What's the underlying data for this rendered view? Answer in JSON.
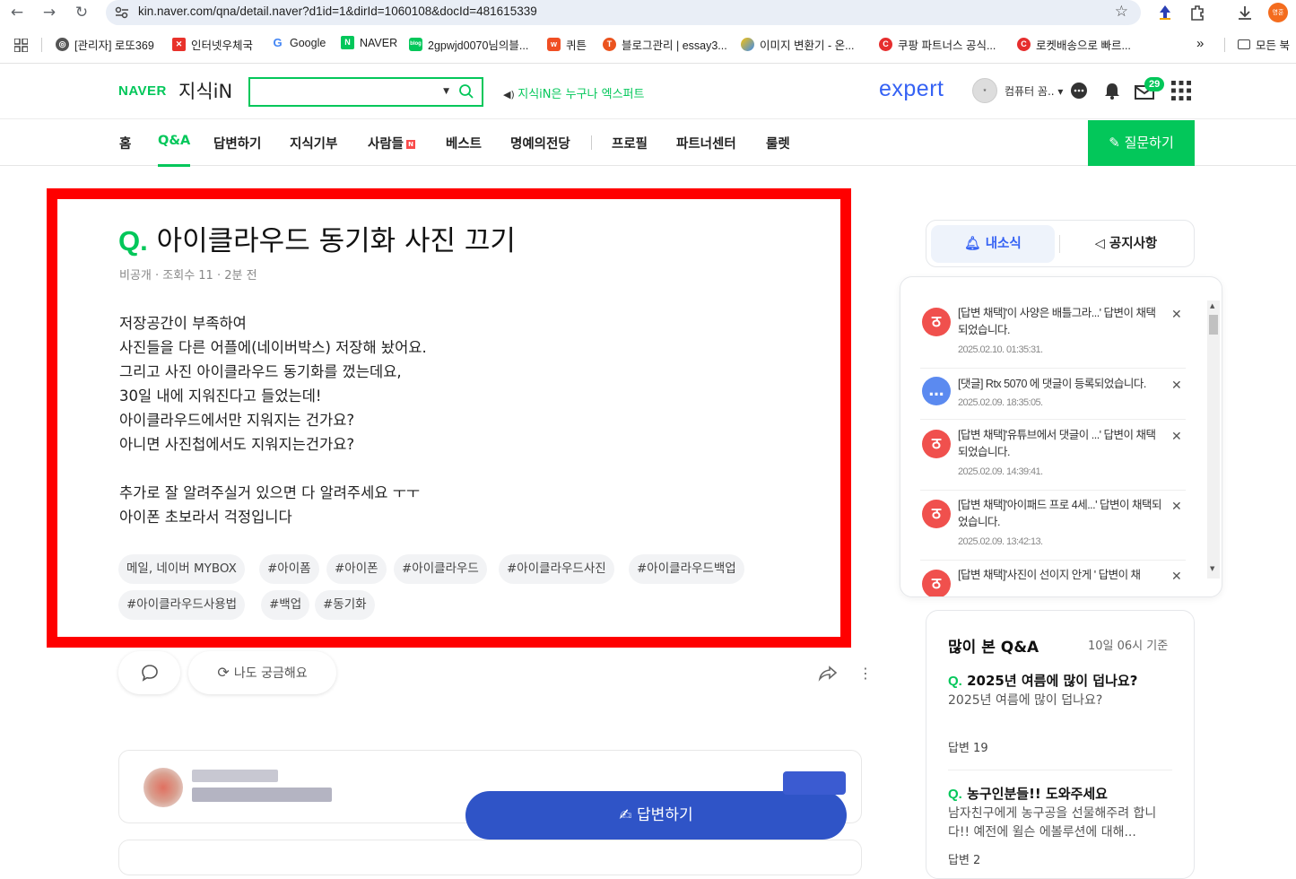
{
  "browser": {
    "url": "kin.naver.com/qna/detail.naver?d1id=1&dirId=1060108&docId=481615339",
    "bookmarks": [
      {
        "label": "[관리자] 로또369",
        "icon": "globe-icon"
      },
      {
        "label": "인터넷우체국",
        "icon": "post-icon"
      },
      {
        "label": "Google",
        "icon": "google-icon"
      },
      {
        "label": "NAVER",
        "icon": "naver-icon"
      },
      {
        "label": "2gpwjd0070님의블...",
        "icon": "blog-icon"
      },
      {
        "label": "퀴튼",
        "icon": "quiten-icon"
      },
      {
        "label": "블로그관리 | essay3...",
        "icon": "tistory-icon"
      },
      {
        "label": "이미지 변환기 - 온...",
        "icon": "converter-icon"
      },
      {
        "label": "쿠팡 파트너스 공식...",
        "icon": "coupang-icon"
      },
      {
        "label": "로켓배송으로 빠르...",
        "icon": "coupang-icon"
      }
    ],
    "bookmarks_more": "»",
    "all_bookmarks": "모든 북",
    "profile_initial": "영훈"
  },
  "header": {
    "logo_naver": "NAVER",
    "logo_kin": "지식iN",
    "search_value": "",
    "expert_tagline": "지식iN은 누구나 엑스퍼트",
    "expert_logo": "expert",
    "username": "컴퓨터 꼼..",
    "notification_count": "29"
  },
  "nav": {
    "items": [
      "홈",
      "Q&A",
      "답변하기",
      "지식기부",
      "사람들",
      "베스트",
      "명예의전당",
      "프로필",
      "파트너센터",
      "룰렛"
    ],
    "active": "Q&A",
    "new_badge": "N",
    "ask_button": "질문하기"
  },
  "question": {
    "q_mark": "Q.",
    "title": "아이클라우드 동기화 사진 끄기",
    "meta": "비공개 · 조회수 11 · 2분 전",
    "body": [
      "저장공간이 부족하여",
      "사진들을 다른 어플에(네이버박스) 저장해 놨어요.",
      "그리고 사진 아이클라우드 동기화를 껐는데요,",
      "30일 내에 지워진다고 들었는데!",
      "아이클라우드에서만 지워지는 건가요?",
      "아니면 사진첩에서도 지워지는건가요?",
      "",
      "추가로 잘 알려주실거 있으면 다 알려주세요 ㅜㅜ",
      "아이폰 초보라서 걱정입니다"
    ],
    "tags": [
      "메일, 네이버 MYBOX",
      "#아이폼",
      "#아이폰",
      "#아이클라우드",
      "#아이클라우드사진",
      "#아이클라우드백업",
      "#아이클라우드사용법",
      "#백업",
      "#동기화"
    ],
    "curious_button": "나도 궁금해요"
  },
  "answer_button": "답변하기",
  "sidebar": {
    "tab_my_news": "내소식",
    "tab_notice": "공지사항",
    "notifications": [
      {
        "text": "[답변 채택]'이 사양은 배틀그라...' 답변이 채택되었습니다.",
        "date": "2025.02.10. 01:35:31.",
        "type": "adopt"
      },
      {
        "text": "[댓글] Rtx 5070 에 댓글이 등록되었습니다.",
        "date": "2025.02.09. 18:35:05.",
        "type": "comment"
      },
      {
        "text": "[답변 채택]'유튜브에서 댓글이 ...' 답변이 채택되었습니다.",
        "date": "2025.02.09. 14:39:41.",
        "type": "adopt"
      },
      {
        "text": "[답변 채택]'아이패드 프로 4세...' 답변이 채택되었습니다.",
        "date": "2025.02.09. 13:42:13.",
        "type": "adopt"
      },
      {
        "text": "[답변 채택]'사진이 선이지 안게 ' 답변이 채",
        "date": "",
        "type": "adopt"
      }
    ],
    "popular_title": "많이 본 Q&A",
    "popular_standard": "10일 06시 기준",
    "popular": [
      {
        "q": "Q.",
        "title": "2025년 여름에 많이 덥나요?",
        "desc": "2025년 여름에 많이 덥나요?",
        "answers": "답변 19"
      },
      {
        "q": "Q.",
        "title": "농구인분들!! 도와주세요",
        "desc": "남자친구에게 농구공을 선물해주려 합니다!! 예전에 윌슨 에볼루션에 대해...",
        "answers": "답변 2"
      }
    ]
  },
  "colors": {
    "naver_green": "#03c75a",
    "expert_blue": "#3562f4",
    "highlight_red": "#ff0000",
    "answer_blue": "#2f54c7",
    "adopt_red": "#f0504d",
    "comment_blue": "#5b8af0"
  }
}
